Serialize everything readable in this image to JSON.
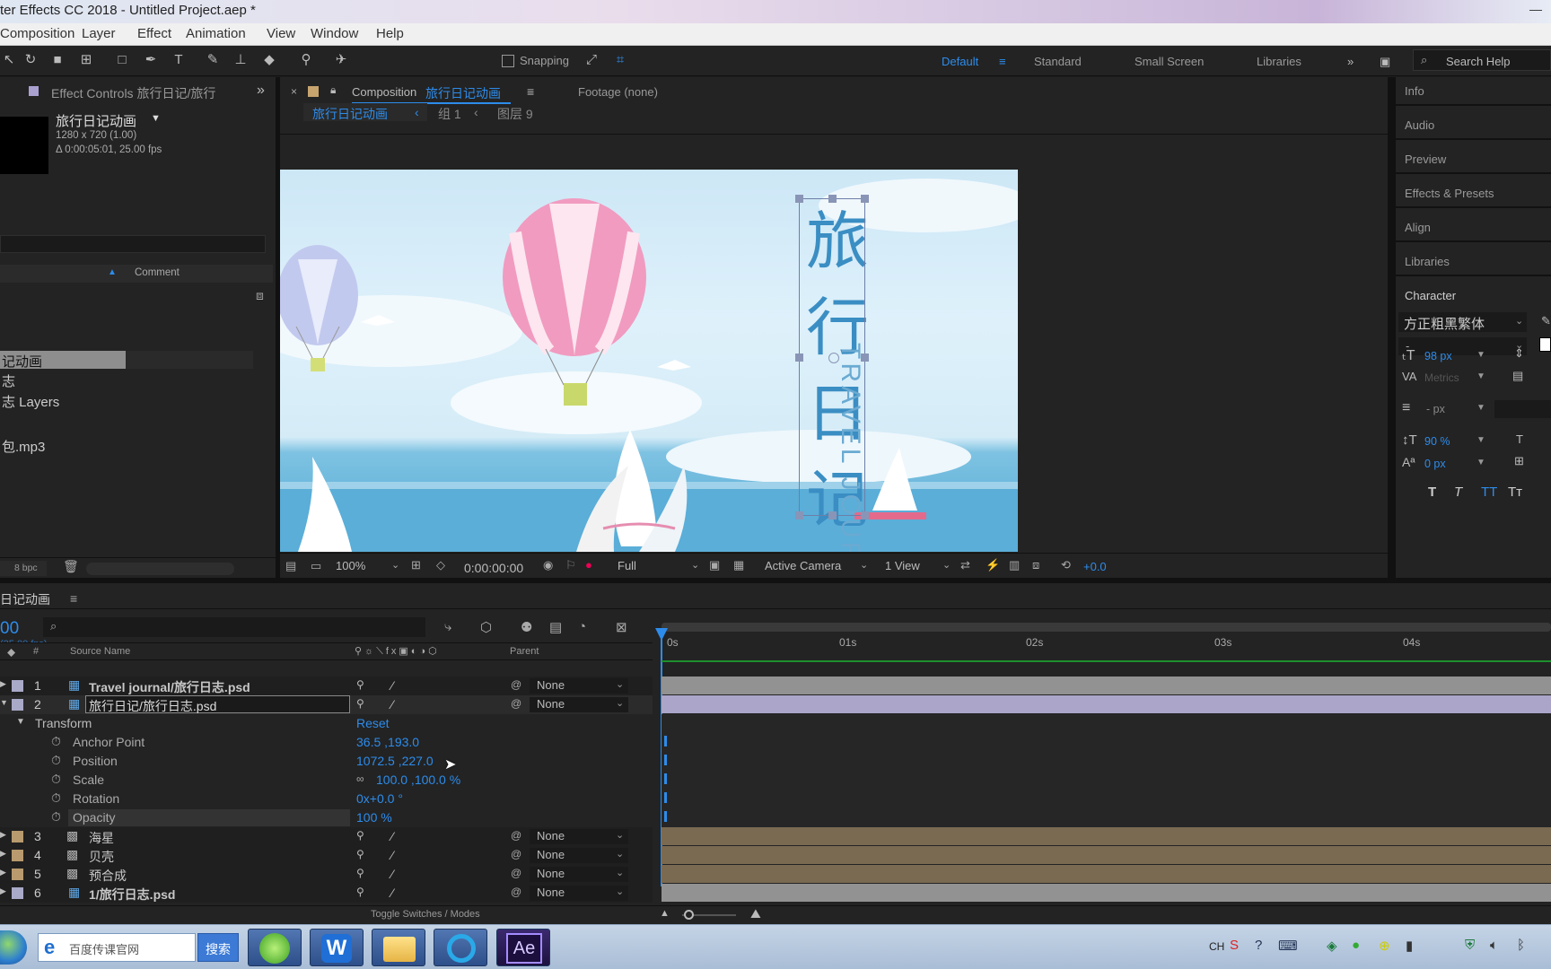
{
  "window": {
    "title": "ter Effects CC 2018 - Untitled Project.aep *",
    "controls": "— "
  },
  "menu": [
    "Composition",
    "Layer",
    "Effect",
    "Animation",
    "View",
    "Window",
    "Help"
  ],
  "toolbar": {
    "snapping": "Snapping",
    "workspaces": [
      "Default",
      "Standard",
      "Small Screen",
      "Libraries"
    ],
    "search_placeholder": "Search Help"
  },
  "left_panel": {
    "tab": "Effect Controls 旅行日记/旅行",
    "item_name": "旅行日记动画",
    "dims": "1280 x 720 (1.00)",
    "duration": "Δ 0:00:05:01, 25.00 fps",
    "comment_header": "Comment",
    "items": [
      "记动画",
      "志",
      "志 Layers",
      "包.mp3"
    ],
    "bpc": "8 bpc"
  },
  "comp": {
    "tab_label": "Composition",
    "comp_name": "旅行日记动画",
    "footage": "Footage (none)",
    "breadcrumb": [
      "旅行日记动画",
      "组 1",
      "图层 9"
    ],
    "art_title": [
      "旅",
      "行",
      "日",
      "记"
    ],
    "art_side": "TRAVEL JOUR",
    "zoom": "100%",
    "timecode": "0:00:00:00",
    "resolution": "Full",
    "camera": "Active Camera",
    "view": "1 View",
    "exposure": "+0.0"
  },
  "right_panel": {
    "items": [
      "Info",
      "Audio",
      "Preview",
      "Effects & Presets",
      "Align",
      "Libraries",
      "Character"
    ],
    "font": "方正粗黑繁体",
    "style": "-",
    "size": "98 px",
    "kerning": "Metrics",
    "leading": "- px",
    "vscale": "90 %",
    "baseline": "0 px",
    "buttons": [
      "T",
      "T",
      "TT",
      "Tт"
    ]
  },
  "timeline": {
    "title": "日记动画",
    "timecode": "00",
    "fps": "(25.00 fps)",
    "col_num": "#",
    "col_source": "Source Name",
    "col_parent": "Parent",
    "ruler": [
      "0s",
      "01s",
      "02s",
      "03s",
      "04s"
    ],
    "layers": [
      {
        "n": "1",
        "name": "Travel journal/旅行日志.psd",
        "parent": "None",
        "color": "#a9a9c8"
      },
      {
        "n": "2",
        "name": "旅行日记/旅行日志.psd",
        "parent": "None",
        "color": "#a9a9c8"
      }
    ],
    "transform": {
      "label": "Transform",
      "reset": "Reset",
      "props": [
        {
          "name": "Anchor Point",
          "value": "36.5 ,193.0"
        },
        {
          "name": "Position",
          "value": "1072.5 ,227.0"
        },
        {
          "name": "Scale",
          "value": "100.0 ,100.0 %"
        },
        {
          "name": "Rotation",
          "value": "0x+0.0 °"
        },
        {
          "name": "Opacity",
          "value": "100 %"
        }
      ]
    },
    "layers2": [
      {
        "n": "3",
        "name": "海星",
        "parent": "None",
        "color": "#b89a6e"
      },
      {
        "n": "4",
        "name": "贝壳",
        "parent": "None",
        "color": "#b89a6e"
      },
      {
        "n": "5",
        "name": "预合成",
        "parent": "None",
        "color": "#b89a6e"
      },
      {
        "n": "6",
        "name": "1/旅行日志.psd",
        "parent": "None",
        "color": "#a9a9c8"
      }
    ],
    "toggle": "Toggle Switches / Modes"
  },
  "taskbar": {
    "search_text": "百度传课官网",
    "search_btn": "搜索",
    "tray_lang": "CH"
  },
  "colors": {
    "accent": "#2d8ceb",
    "sky": "#c9e6f6",
    "sea": "#5bb4dc"
  }
}
